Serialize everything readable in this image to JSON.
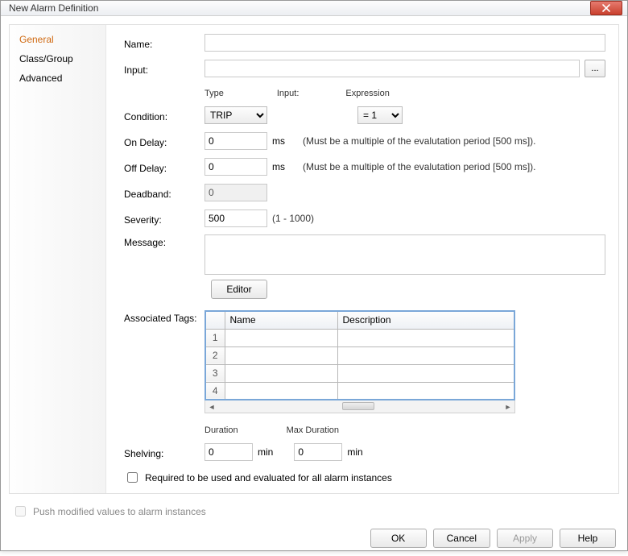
{
  "window": {
    "title": "New Alarm Definition"
  },
  "sidebar": {
    "items": [
      {
        "label": "General",
        "selected": true
      },
      {
        "label": "Class/Group",
        "selected": false
      },
      {
        "label": "Advanced",
        "selected": false
      }
    ]
  },
  "labels": {
    "name": "Name:",
    "input": "Input:",
    "condition": "Condition:",
    "on_delay": "On Delay:",
    "off_delay": "Off Delay:",
    "deadband": "Deadband:",
    "severity": "Severity:",
    "message": "Message:",
    "assoc_tags": "Associated Tags:",
    "shelving": "Shelving:"
  },
  "condition": {
    "type_label": "Type",
    "input_label": "Input:",
    "expression_label": "Expression",
    "type_value": "TRIP",
    "expression_value": "= 1"
  },
  "fields": {
    "name": "",
    "input": "",
    "on_delay": "0",
    "on_delay_unit": "ms",
    "off_delay": "0",
    "off_delay_unit": "ms",
    "deadband": "0",
    "severity": "500",
    "severity_hint": "(1 - 1000)",
    "delay_hint": "(Must be a multiple of the evalutation period [500 ms]).",
    "message": ""
  },
  "buttons": {
    "browse": "...",
    "editor": "Editor",
    "ok": "OK",
    "cancel": "Cancel",
    "apply": "Apply",
    "help": "Help"
  },
  "tags_table": {
    "headers": {
      "name": "Name",
      "description": "Description"
    },
    "rows": [
      {
        "n": "1",
        "name": "",
        "description": ""
      },
      {
        "n": "2",
        "name": "",
        "description": ""
      },
      {
        "n": "3",
        "name": "",
        "description": ""
      },
      {
        "n": "4",
        "name": "",
        "description": ""
      }
    ]
  },
  "shelving": {
    "duration_label": "Duration",
    "max_duration_label": "Max Duration",
    "duration": "0",
    "duration_unit": "min",
    "max_duration": "0",
    "max_duration_unit": "min"
  },
  "checkboxes": {
    "required": "Required to be used and evaluated for all alarm instances",
    "push": "Push modified values to alarm instances"
  }
}
